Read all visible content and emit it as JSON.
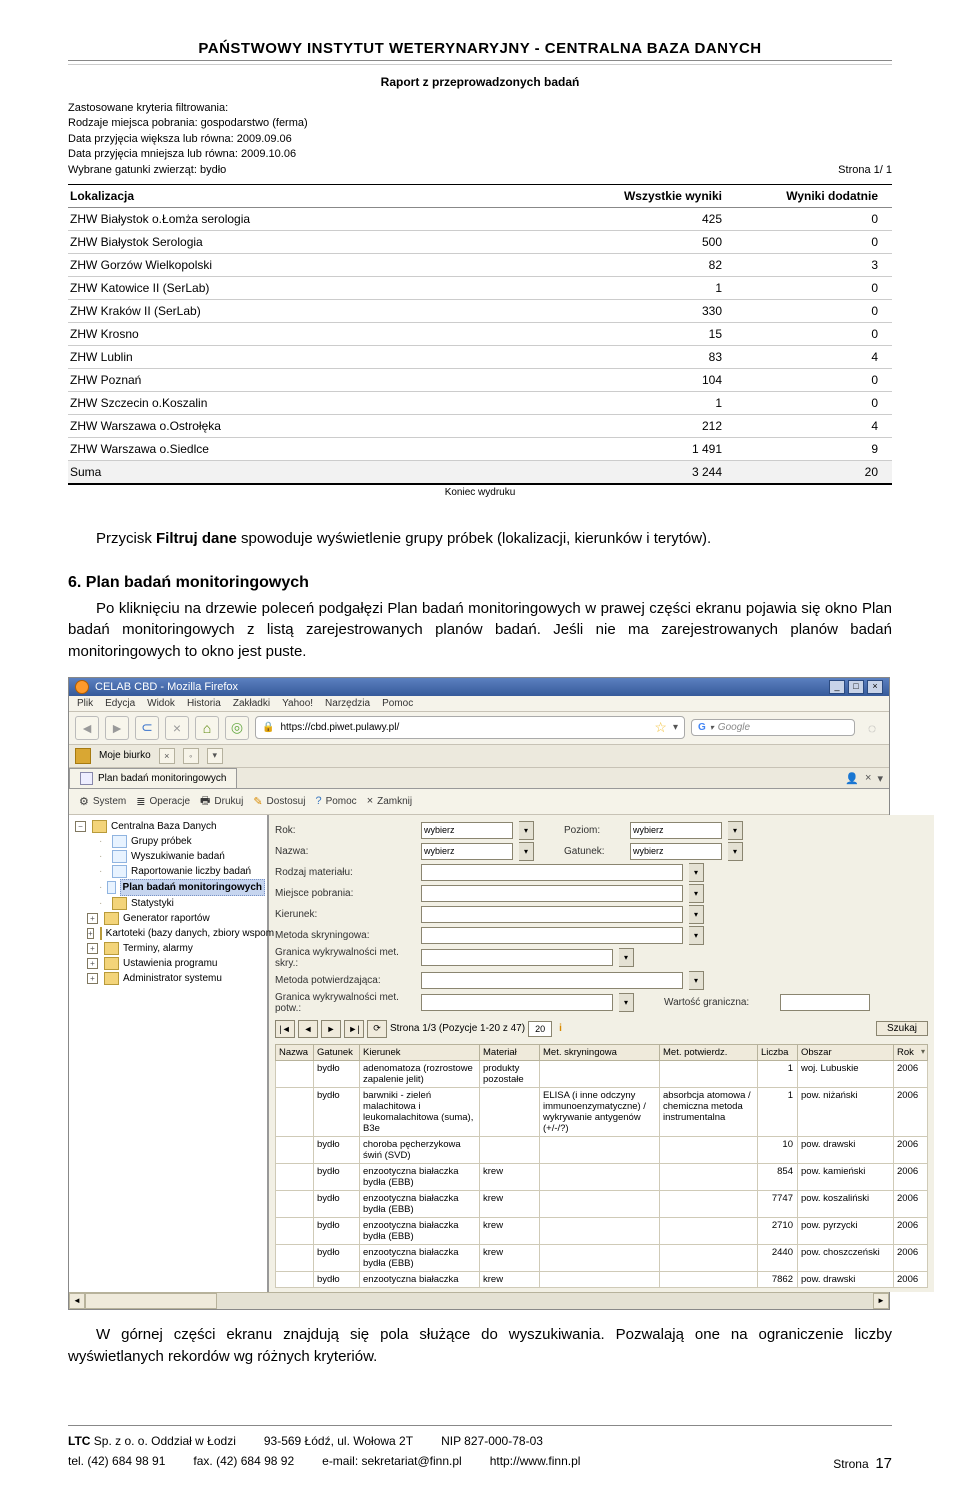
{
  "report": {
    "title": "PAŃSTWOWY INSTYTUT WETERYNARYJNY - CENTRALNA BAZA DANYCH",
    "subtitle": "Raport z przeprowadzonych badań",
    "filters_heading": "Zastosowane kryteria filtrowania:",
    "filters": [
      "Rodzaje miejsca pobrania: gospodarstwo (ferma)",
      "Data przyjęcia większa lub równa: 2009.09.06",
      "Data przyjęcia mniejsza lub równa: 2009.10.06",
      "Wybrane gatunki zwierząt: bydło"
    ],
    "pagenote": "Strona 1/ 1",
    "columns": [
      "Lokalizacja",
      "Wszystkie wyniki",
      "Wyniki dodatnie"
    ],
    "rows": [
      [
        "ZHW Białystok o.Łomża serologia",
        "425",
        "0"
      ],
      [
        "ZHW Białystok Serologia",
        "500",
        "0"
      ],
      [
        "ZHW Gorzów Wielkopolski",
        "82",
        "3"
      ],
      [
        "ZHW Katowice II (SerLab)",
        "1",
        "0"
      ],
      [
        "ZHW Kraków II (SerLab)",
        "330",
        "0"
      ],
      [
        "ZHW Krosno",
        "15",
        "0"
      ],
      [
        "ZHW Lublin",
        "83",
        "4"
      ],
      [
        "ZHW Poznań",
        "104",
        "0"
      ],
      [
        "ZHW Szczecin o.Koszalin",
        "1",
        "0"
      ],
      [
        "ZHW Warszawa o.Ostrołęka",
        "212",
        "4"
      ],
      [
        "ZHW Warszawa o.Siedlce",
        "1 491",
        "9"
      ]
    ],
    "sum_label": "Suma",
    "sum_all": "3 244",
    "sum_pos": "20",
    "endprint": "Koniec wydruku"
  },
  "body": {
    "p1a": "Przycisk ",
    "p1b": "Filtruj dane",
    "p1c": " spowoduje wyświetlenie grupy próbek (lokalizacji, kierunków i terytów).",
    "section_num": "6.",
    "section_title": "Plan badań monitoringowych",
    "p2a": "Po kliknięciu na drzewie poleceń podgałęzi ",
    "p2b": "Plan badań monitoringowych",
    "p2c": " w prawej części ekranu pojawia się okno ",
    "p2d": "Plan badań monitoringowych",
    "p2e": " z listą zarejestrowanych planów badań. Jeśli nie ma zarejestrowanych planów badań monitoringowych to okno jest puste.",
    "p3": "W górnej części ekranu znajdują się pola służące do wyszukiwania. Pozwalają one na ograniczenie liczby wyświetlanych rekordów wg różnych kryteriów."
  },
  "ss": {
    "titlebar": "CELAB CBD - Mozilla Firefox",
    "menubar": [
      "Plik",
      "Edycja",
      "Widok",
      "Historia",
      "Zakładki",
      "Yahoo!",
      "Narzędzia",
      "Pomoc"
    ],
    "url": "https://cbd.piwet.pulawy.pl/",
    "search_placeholder": "Google",
    "biurko": "Moje biurko",
    "tab_label": "Plan badań monitoringowych",
    "toolbar2": [
      "System",
      "Operacje",
      "Drukuj",
      "Dostosuj",
      "Pomoc",
      "Zamknij"
    ],
    "tree": {
      "root": "Centralna Baza Danych",
      "items": [
        "Grupy próbek",
        "Wyszukiwanie badań",
        "Raportowanie liczby badań",
        "Plan badań monitoringowych",
        "Statystyki",
        "Generator raportów",
        "Kartoteki (bazy danych, zbiory wspom",
        "Terminy, alarmy",
        "Ustawienia programu",
        "Administrator systemu"
      ],
      "selected_index": 3
    },
    "form": {
      "rows": [
        {
          "label": "Rok:",
          "value": "wybierz",
          "label2": "Poziom:",
          "value2": "wybierz"
        },
        {
          "label": "Nazwa:",
          "value": "wybierz",
          "label2": "Gatunek:",
          "value2": "wybierz"
        },
        {
          "label": "Rodzaj materiału:",
          "wide": true
        },
        {
          "label": "Miejsce pobrania:",
          "wide": true
        },
        {
          "label": "Kierunek:",
          "wide": true
        },
        {
          "label": "Metoda skryningowa:",
          "wide": true
        },
        {
          "label": "Granica wykrywalności met. skry.:",
          "dd": true
        },
        {
          "label": "Metoda potwierdzająca:",
          "wide": true
        },
        {
          "label": "Granica wykrywalności met. potw.:",
          "dd": true,
          "extra_label": "Wartość graniczna:"
        }
      ]
    },
    "pager": {
      "text": "Strona 1/3 (Pozycje 1-20 z 47)",
      "perpage": "20",
      "szukaj": "Szukaj"
    },
    "grid": {
      "headers": [
        "Nazwa",
        "Gatunek",
        "Kierunek",
        "Materiał",
        "Met. skryningowa",
        "Met. potwierdz.",
        "Liczba",
        "Obszar",
        "Rok"
      ],
      "rows": [
        {
          "g": "bydło",
          "k": "adenomatoza (rozrostowe zapalenie jelit)",
          "m": "produkty pozostałe",
          "s": "",
          "p": "",
          "l": "1",
          "o": "woj. Lubuskie",
          "r": "2006"
        },
        {
          "g": "bydło",
          "k": "barwniki - zieleń malachitowa i leukomalachitowa (suma), B3e",
          "m": "",
          "s": "ELISA (i inne odczyny immunoenzymatyczne) / wykrywanie antygenów (+/-/?)",
          "p": "absorbcja atomowa / chemiczna metoda instrumentalna",
          "l": "1",
          "o": "pow. niżański",
          "r": "2006"
        },
        {
          "g": "bydło",
          "k": "choroba pęcherzykowa świń (SVD)",
          "m": "",
          "s": "",
          "p": "",
          "l": "10",
          "o": "pow. drawski",
          "r": "2006"
        },
        {
          "g": "bydło",
          "k": "enzootyczna białaczka bydła (EBB)",
          "m": "krew",
          "s": "",
          "p": "",
          "l": "854",
          "o": "pow. kamieński",
          "r": "2006"
        },
        {
          "g": "bydło",
          "k": "enzootyczna białaczka bydła (EBB)",
          "m": "krew",
          "s": "",
          "p": "",
          "l": "7747",
          "o": "pow. koszaliński",
          "r": "2006"
        },
        {
          "g": "bydło",
          "k": "enzootyczna białaczka bydła (EBB)",
          "m": "krew",
          "s": "",
          "p": "",
          "l": "2710",
          "o": "pow. pyrzycki",
          "r": "2006"
        },
        {
          "g": "bydło",
          "k": "enzootyczna białaczka bydła (EBB)",
          "m": "krew",
          "s": "",
          "p": "",
          "l": "2440",
          "o": "pow. choszczeński",
          "r": "2006"
        },
        {
          "g": "bydło",
          "k": "enzootyczna białaczka",
          "m": "krew",
          "s": "",
          "p": "",
          "l": "7862",
          "o": "pow. drawski",
          "r": "2006"
        }
      ]
    }
  },
  "footer": {
    "l1a": "LTC",
    "l1b": "Sp. z o. o. Oddział w Łodzi",
    "l1c": "93-569 Łódź, ul. Wołowa 2T",
    "l1d": "NIP 827-000-78-03",
    "l2a": "tel. (42) 684 98 91",
    "l2b": "fax. (42) 684 98 92",
    "l2c": "e-mail: sekretariat@finn.pl",
    "l2d": "http://www.finn.pl",
    "l2e": "Strona",
    "l2f": "17"
  }
}
